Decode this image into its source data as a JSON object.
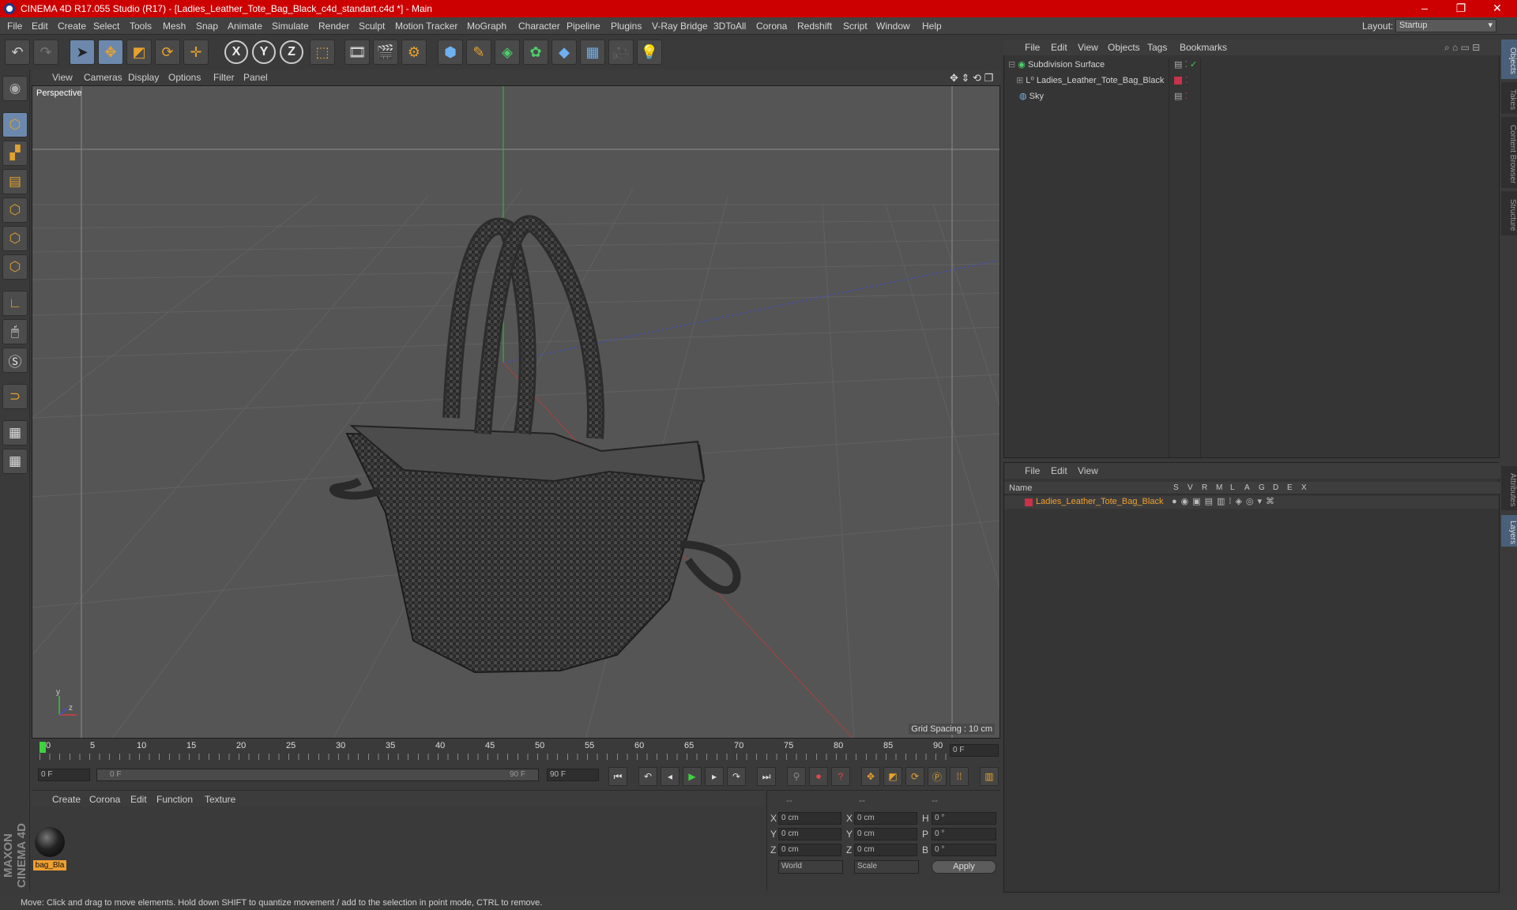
{
  "window": {
    "title": "CINEMA 4D R17.055 Studio (R17) - [Ladies_Leather_Tote_Bag_Black_c4d_standart.c4d *] - Main",
    "minimize": "–",
    "restore": "❐",
    "close": "✕"
  },
  "menu": [
    "File",
    "Edit",
    "Create",
    "Select",
    "Tools",
    "Mesh",
    "Snap",
    "Animate",
    "Simulate",
    "Render",
    "Sculpt",
    "Motion Tracker",
    "MoGraph",
    "Character",
    "Pipeline",
    "Plugins",
    "V-Ray Bridge",
    "3DToAll",
    "Corona",
    "Redshift",
    "Script",
    "Window",
    "Help"
  ],
  "layout": {
    "label": "Layout:",
    "value": "Startup"
  },
  "viewport": {
    "menu": [
      "View",
      "Cameras",
      "Display",
      "Options",
      "Filter",
      "Panel"
    ],
    "camera_label": "Perspective",
    "grid_spacing": "Grid Spacing : 10 cm"
  },
  "timeline": {
    "ticks": [
      "0",
      "5",
      "10",
      "15",
      "20",
      "25",
      "30",
      "35",
      "40",
      "45",
      "50",
      "55",
      "60",
      "65",
      "70",
      "75",
      "80",
      "85",
      "90"
    ],
    "current_frame": "0 F",
    "start_field": "0 F",
    "range_start": "0 F",
    "range_end": "90 F",
    "end_field": "90 F"
  },
  "material_manager": {
    "menu": [
      "Create",
      "Corona",
      "Edit",
      "Function",
      "Texture"
    ],
    "materials": [
      {
        "name": "bag_Bla"
      }
    ]
  },
  "coordinates": {
    "header": [
      "--",
      "--",
      "--"
    ],
    "rows": [
      {
        "a": "X",
        "v1": "0 cm",
        "b": "X",
        "v2": "0 cm",
        "c": "H",
        "v3": "0 °"
      },
      {
        "a": "Y",
        "v1": "0 cm",
        "b": "Y",
        "v2": "0 cm",
        "c": "P",
        "v3": "0 °"
      },
      {
        "a": "Z",
        "v1": "0 cm",
        "b": "Z",
        "v2": "0 cm",
        "c": "B",
        "v3": "0 °"
      }
    ],
    "mode1": "World",
    "mode2": "Scale",
    "apply": "Apply"
  },
  "object_manager": {
    "menu": [
      "File",
      "Edit",
      "View",
      "Objects",
      "Tags",
      "Bookmarks"
    ],
    "objects": [
      {
        "name": "Subdivision Surface"
      },
      {
        "name": "Ladies_Leather_Tote_Bag_Black"
      },
      {
        "name": "Sky"
      }
    ]
  },
  "layer_manager": {
    "menu": [
      "File",
      "Edit",
      "View"
    ],
    "name_header": "Name",
    "columns": [
      "S",
      "V",
      "R",
      "M",
      "L",
      "A",
      "G",
      "D",
      "E",
      "X"
    ],
    "layers": [
      {
        "name": "Ladies_Leather_Tote_Bag_Black",
        "color": "#c8324a"
      }
    ]
  },
  "side_tabs": [
    "Objects",
    "Takes",
    "Content Browser",
    "Structure",
    "Attributes",
    "Layers"
  ],
  "brand": "MAXON CINEMA 4D",
  "status": "Move: Click and drag to move elements. Hold down SHIFT to quantize movement / add to the selection in point mode, CTRL to remove.",
  "colors": {
    "title_bar": "#cc0000",
    "accent": "#e8a22c",
    "layer_name": "#f0a030",
    "selection": "#6c89ad"
  }
}
